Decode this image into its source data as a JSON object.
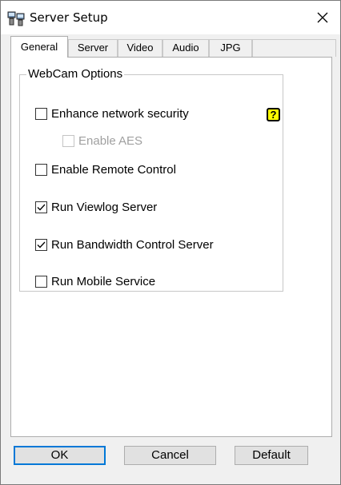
{
  "window": {
    "title": "Server Setup"
  },
  "icons": {
    "app": "server-setup-icon",
    "close": "close-icon",
    "help": "help-icon"
  },
  "tabs": [
    {
      "label": "General",
      "active": true
    },
    {
      "label": "Server"
    },
    {
      "label": "Video"
    },
    {
      "label": "Audio"
    },
    {
      "label": "JPG"
    }
  ],
  "group": {
    "label": "WebCam Options",
    "help_glyph": "?",
    "options": [
      {
        "label": "Enhance network security",
        "checked": false,
        "enabled": true
      },
      {
        "label": "Enable AES",
        "checked": false,
        "enabled": false
      },
      {
        "label": "Enable Remote Control",
        "checked": false,
        "enabled": true
      },
      {
        "label": "Run Viewlog Server",
        "checked": true,
        "enabled": true
      },
      {
        "label": "Run Bandwidth Control Server",
        "checked": true,
        "enabled": true
      },
      {
        "label": "Run Mobile Service",
        "checked": false,
        "enabled": true
      }
    ]
  },
  "buttons": {
    "ok": "OK",
    "cancel": "Cancel",
    "default": "Default"
  },
  "colors": {
    "help_bg": "#ffff00",
    "focus": "#0078d7",
    "dialog_bg": "#f0f0f0"
  }
}
